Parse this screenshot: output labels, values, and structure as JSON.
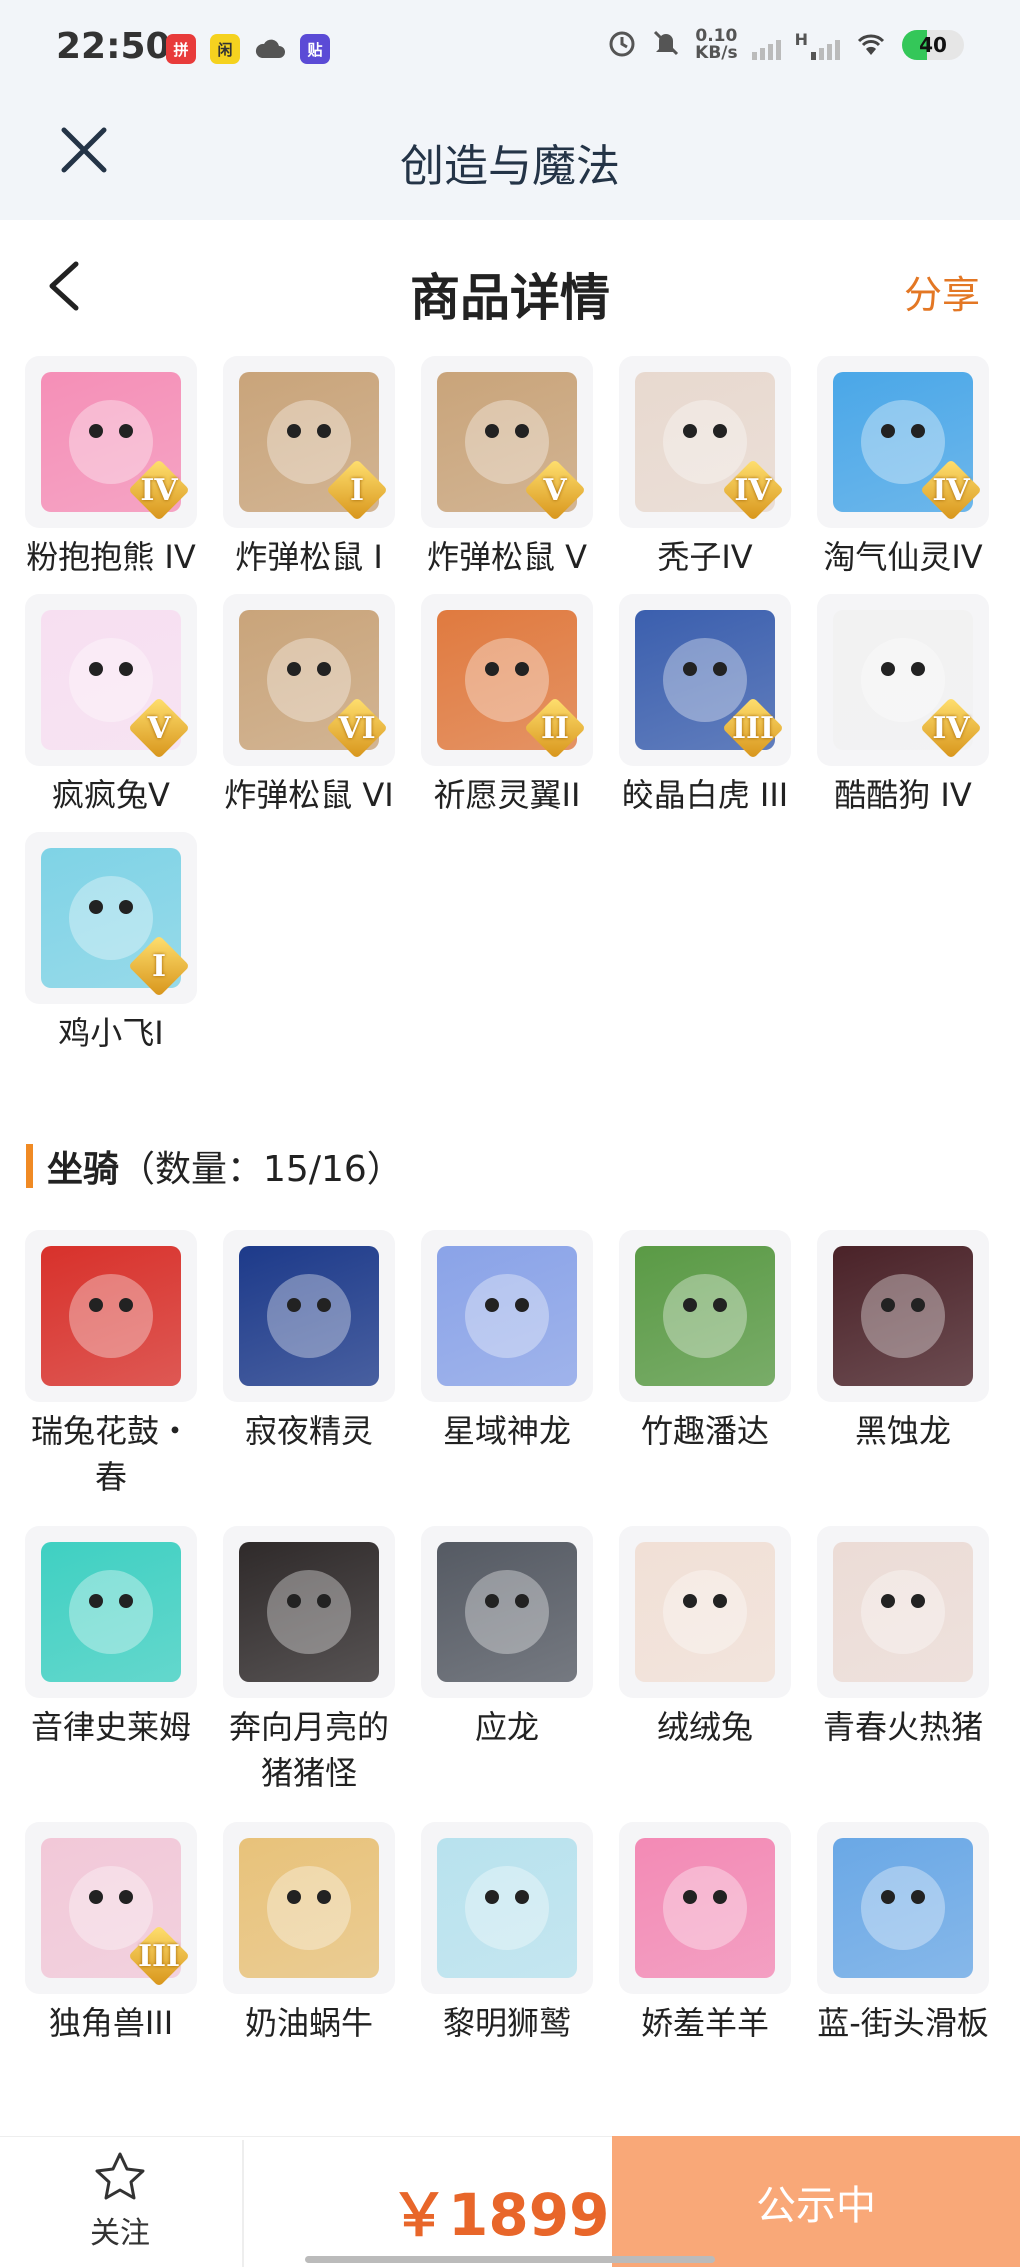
{
  "status_bar": {
    "time": "22:50",
    "speed_value": "0.10",
    "speed_unit": "KB/s",
    "network_h": "H",
    "battery": "40",
    "icons": [
      "app-red-icon",
      "app-yellow-icon",
      "cloud-icon",
      "app-purple-icon",
      "alarm-icon",
      "mute-icon",
      "signal-icon",
      "wifi-icon"
    ]
  },
  "app_header": {
    "title": "创造与魔法"
  },
  "page_header": {
    "title": "商品详情",
    "share_label": "分享"
  },
  "items": [
    {
      "label": "粉抱抱熊 IV",
      "rank": "IV",
      "color": "#f58fb7"
    },
    {
      "label": "炸弹松鼠 I",
      "rank": "I",
      "color": "#c9a47a"
    },
    {
      "label": "炸弹松鼠 V",
      "rank": "V",
      "color": "#c9a47a"
    },
    {
      "label": "秃子IV",
      "rank": "IV",
      "color": "#e8d9cf"
    },
    {
      "label": "淘气仙灵IV",
      "rank": "IV",
      "color": "#4aa7e8"
    },
    {
      "label": "疯疯兔V",
      "rank": "V",
      "color": "#f7dff1"
    },
    {
      "label": "炸弹松鼠 VI",
      "rank": "VI",
      "color": "#c9a47a"
    },
    {
      "label": "祈愿灵翼II",
      "rank": "II",
      "color": "#e07a3f"
    },
    {
      "label": "皎晶白虎 III",
      "rank": "III",
      "color": "#3b5fae"
    },
    {
      "label": "酷酷狗 IV",
      "rank": "IV",
      "color": "#f2f2f2"
    },
    {
      "label": "鸡小飞I",
      "rank": "I",
      "color": "#7fd3e6"
    }
  ],
  "mounts_section": {
    "title": "坐骑",
    "count": "（数量：15/16）"
  },
  "mounts": [
    {
      "label": "瑞兔花鼓・春",
      "color": "#d8312b"
    },
    {
      "label": "寂夜精灵",
      "color": "#1d3a8a"
    },
    {
      "label": "星域神龙",
      "color": "#8aa3e8"
    },
    {
      "label": "竹趣潘达",
      "color": "#5a9a45"
    },
    {
      "label": "黑蚀龙",
      "color": "#4a2228"
    },
    {
      "label": "音律史莱姆",
      "color": "#3fd0c2"
    },
    {
      "label": "奔向月亮的猪猪怪",
      "color": "#2f2a2a"
    },
    {
      "label": "应龙",
      "color": "#555a63"
    },
    {
      "label": "绒绒兔",
      "color": "#f1e0d6"
    },
    {
      "label": "青春火热猪",
      "color": "#ecdcd6"
    },
    {
      "label": "独角兽III",
      "color": "#f2c8d8",
      "rank": "III"
    },
    {
      "label": "奶油蜗牛",
      "color": "#e8c27a"
    },
    {
      "label": "黎明狮鹫",
      "color": "#b8e2ee"
    },
    {
      "label": "娇羞羊羊",
      "color": "#f38ab5"
    },
    {
      "label": "蓝-街头滑板",
      "color": "#6aa8e6"
    }
  ],
  "bottom_bar": {
    "follow_label": "关注",
    "price": "￥1899",
    "status_label": "公示中"
  }
}
